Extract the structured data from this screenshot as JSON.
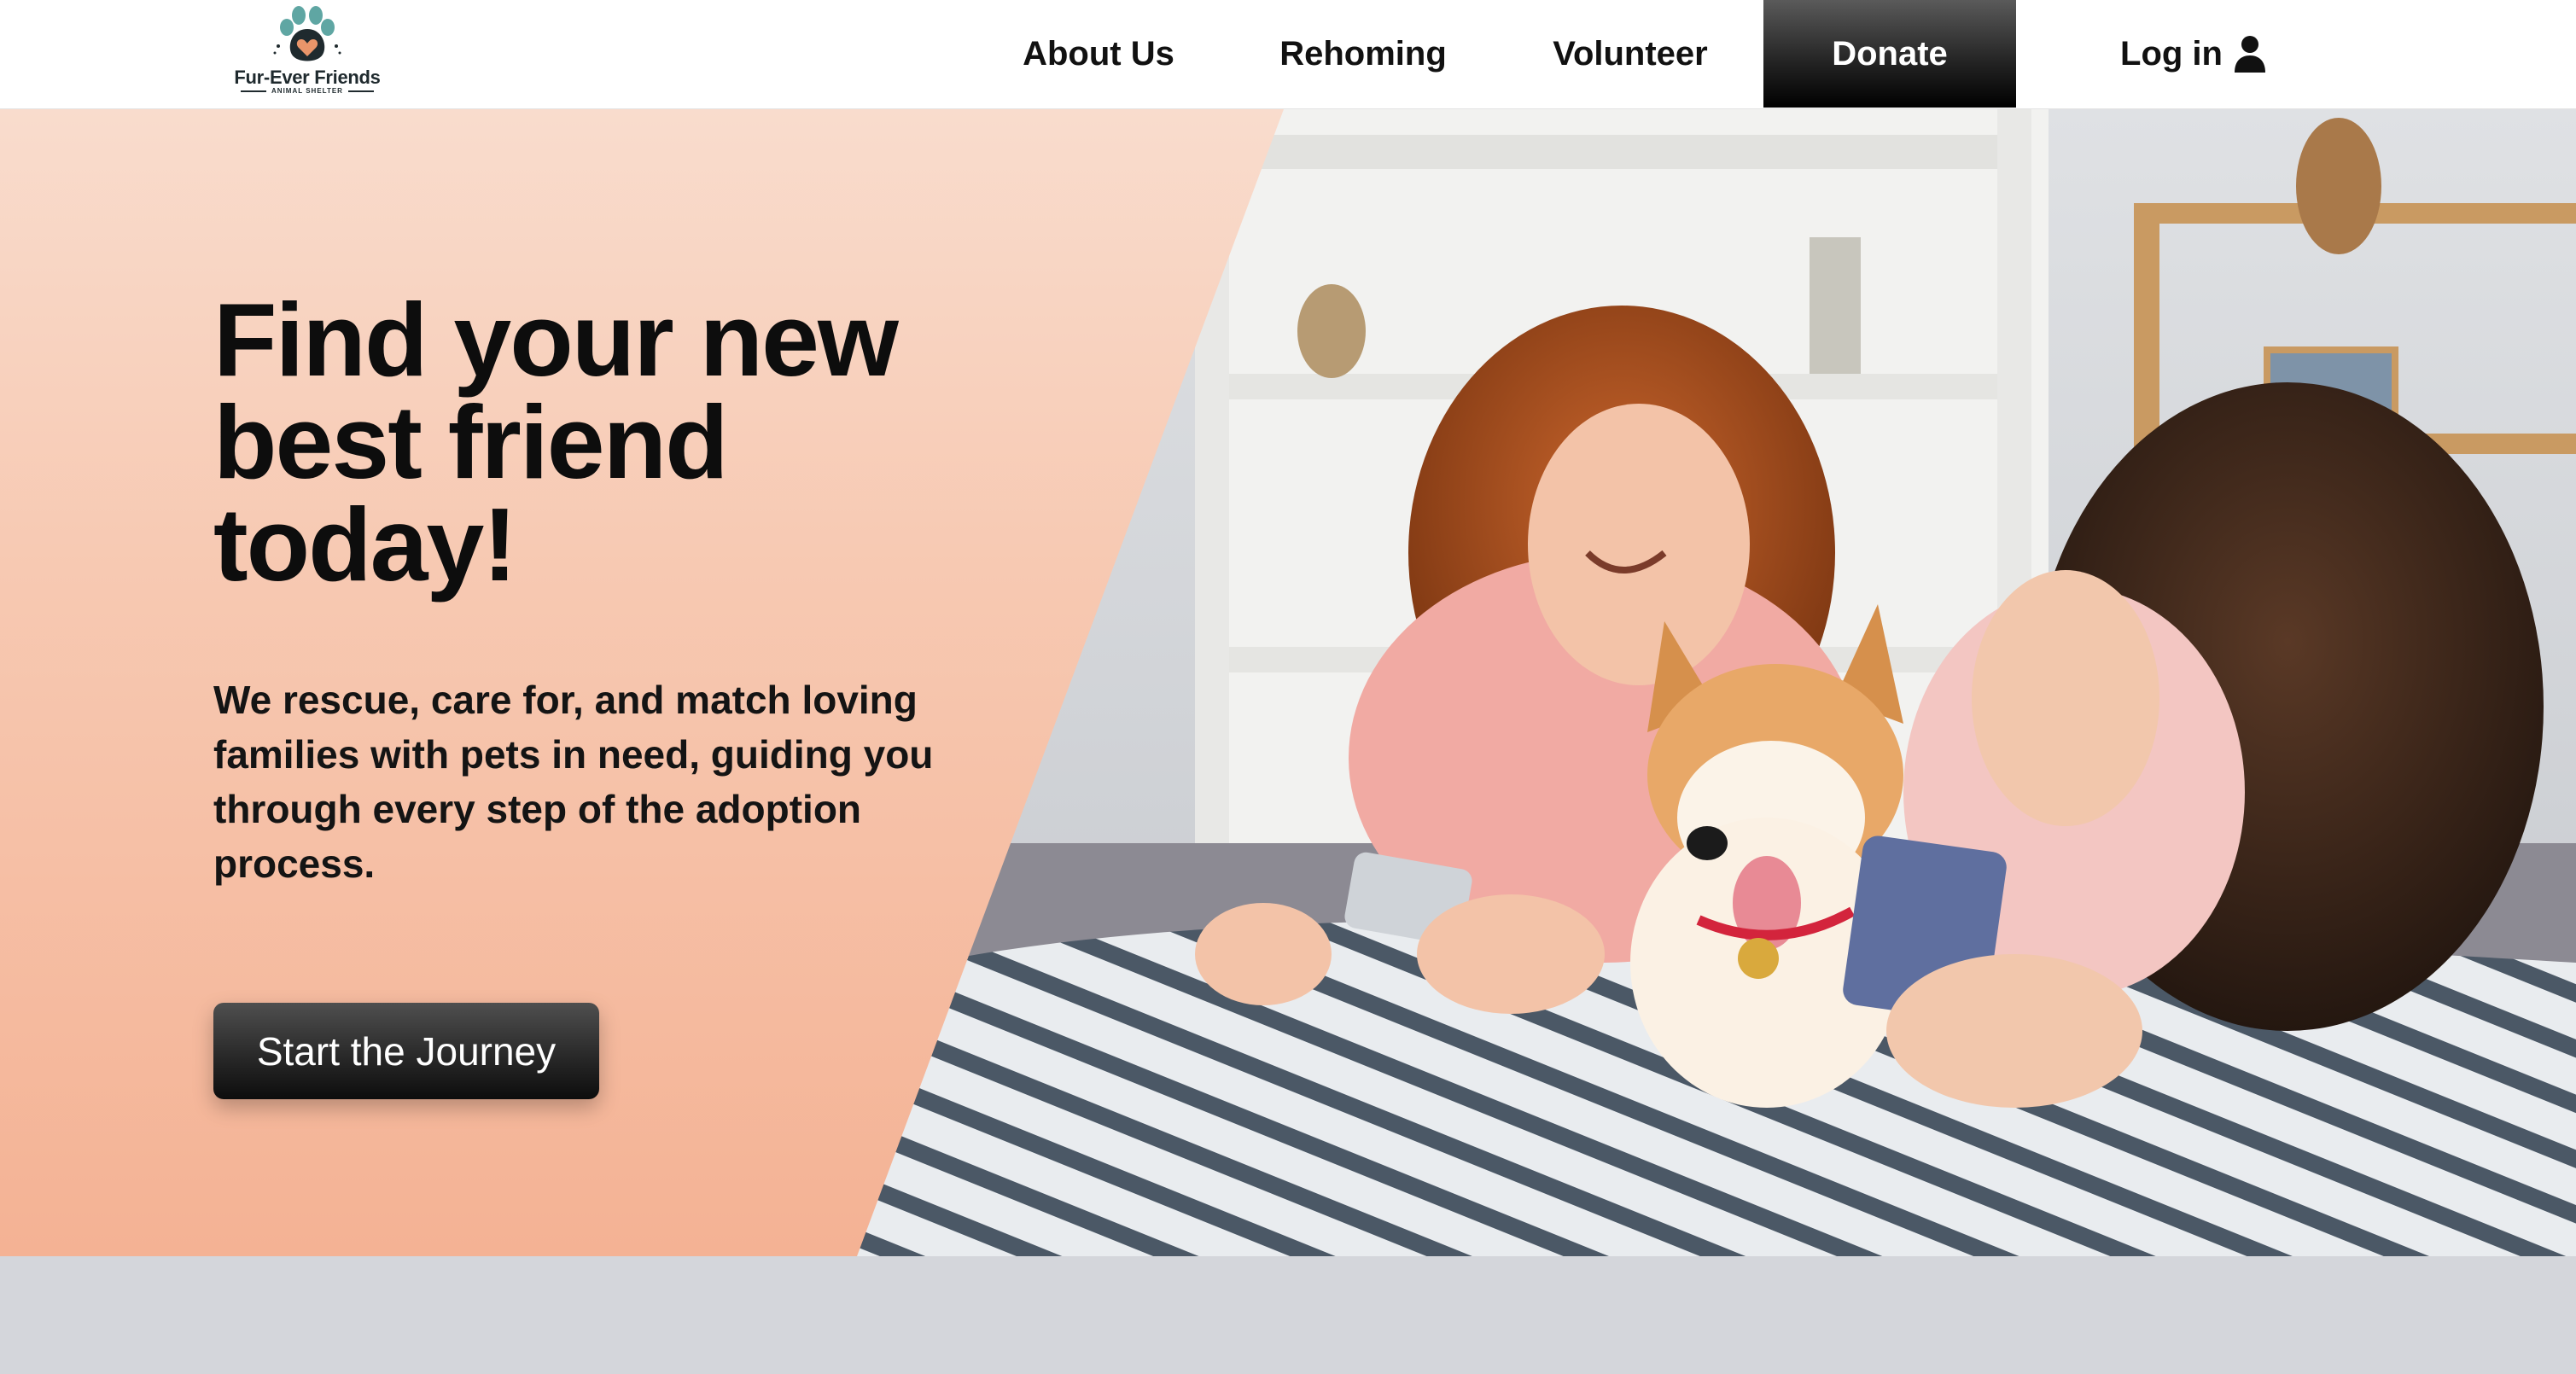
{
  "brand": {
    "name": "Fur-Ever Friends",
    "tagline": "ANIMAL SHELTER",
    "logo_icon": "paw-heart-icon",
    "colors": {
      "paw": "#5fa6a3",
      "heart": "#e9956a",
      "text": "#1f2a2e"
    }
  },
  "nav": {
    "items": [
      {
        "label": "About Us"
      },
      {
        "label": "Rehoming"
      },
      {
        "label": "Volunteer"
      },
      {
        "label": "Donate",
        "active_style": "dark-gradient"
      }
    ],
    "login": {
      "label": "Log in",
      "icon": "user-icon"
    }
  },
  "hero": {
    "title": "Find your new\nbest friend\ntoday!",
    "subtitle": "We rescue, care for, and match loving families with pets in need, guiding you through every step of the adoption process.",
    "cta_label": "Start the Journey",
    "image": "photo of two smiling women lying on a striped blanket with a shiba inu dog, looking at their phones",
    "panel_colors": {
      "top": "#f9dccd",
      "bottom": "#f4b294"
    }
  }
}
